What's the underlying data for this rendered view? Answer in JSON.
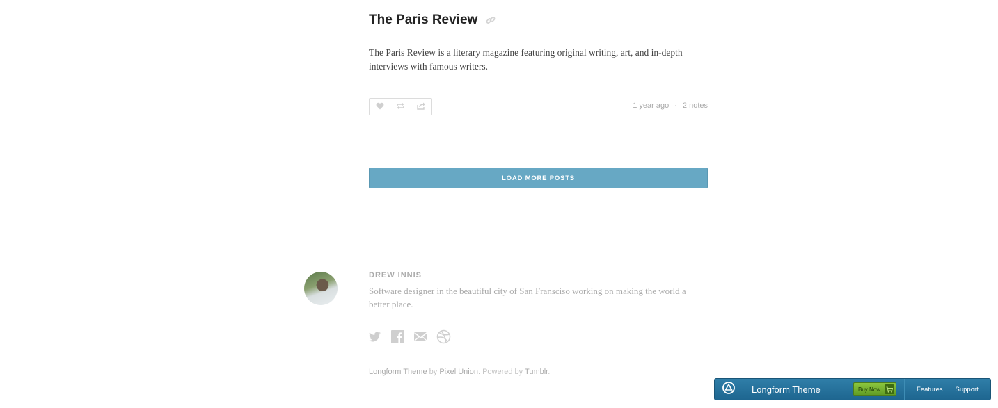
{
  "post": {
    "title": "The Paris Review",
    "body": "The Paris Review is a literary magazine featuring original writing, art, and in-depth interviews with famous writers.",
    "time": "1 year ago",
    "separator": "·",
    "notes": "2 notes"
  },
  "load_more": {
    "label": "LOAD MORE POSTS"
  },
  "author": {
    "name": "DREW INNIS",
    "bio": "Software designer in the beautiful city of San Fransciso working on making the world a better place."
  },
  "credits": {
    "theme": "Longform Theme",
    "by": " by ",
    "maker": "Pixel Union",
    "powered": ". Powered by ",
    "platform": "Tumblr",
    "end": "."
  },
  "theme_bar": {
    "name": "Longform Theme",
    "buy_label": "Buy Now",
    "features": "Features",
    "support": "Support"
  },
  "colors": {
    "accent": "#67a8c4",
    "theme_bar": "#2a769f",
    "buy_green": "#7ab833"
  }
}
